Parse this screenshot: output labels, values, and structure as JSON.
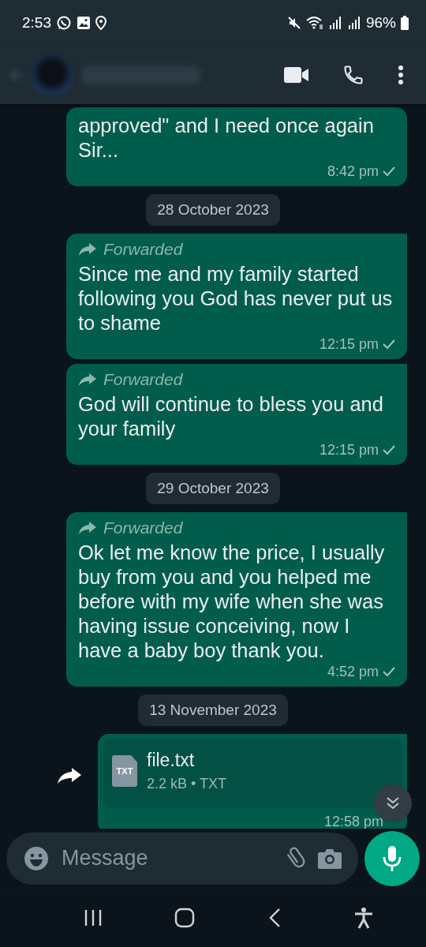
{
  "status_bar": {
    "time": "2:53",
    "battery": "96%"
  },
  "messages": [
    {
      "kind": "message",
      "text": "approved\" and I need once again\nSir...",
      "time": "8:42 pm"
    },
    {
      "kind": "date",
      "text": "28 October 2023"
    },
    {
      "kind": "message",
      "forward_label": "Forwarded",
      "text": "Since me and my family started following you God has never put us to shame",
      "time": "12:15 pm"
    },
    {
      "kind": "message",
      "forward_label": "Forwarded",
      "text": "God will continue to bless you and your family",
      "time": "12:15 pm"
    },
    {
      "kind": "date",
      "text": "29 October 2023"
    },
    {
      "kind": "message",
      "forward_label": "Forwarded",
      "text": "Ok let me know the price, I usually buy from you and you helped me before with my wife when she was having issue conceiving, now I have a baby boy thank you.",
      "time": "4:52 pm"
    },
    {
      "kind": "date",
      "text": "13 November 2023"
    },
    {
      "kind": "file",
      "file_type": "TXT",
      "name": "file.txt",
      "meta": "2.2 kB • TXT",
      "time": "12:58 pm"
    }
  ],
  "composer": {
    "placeholder": "Message"
  }
}
